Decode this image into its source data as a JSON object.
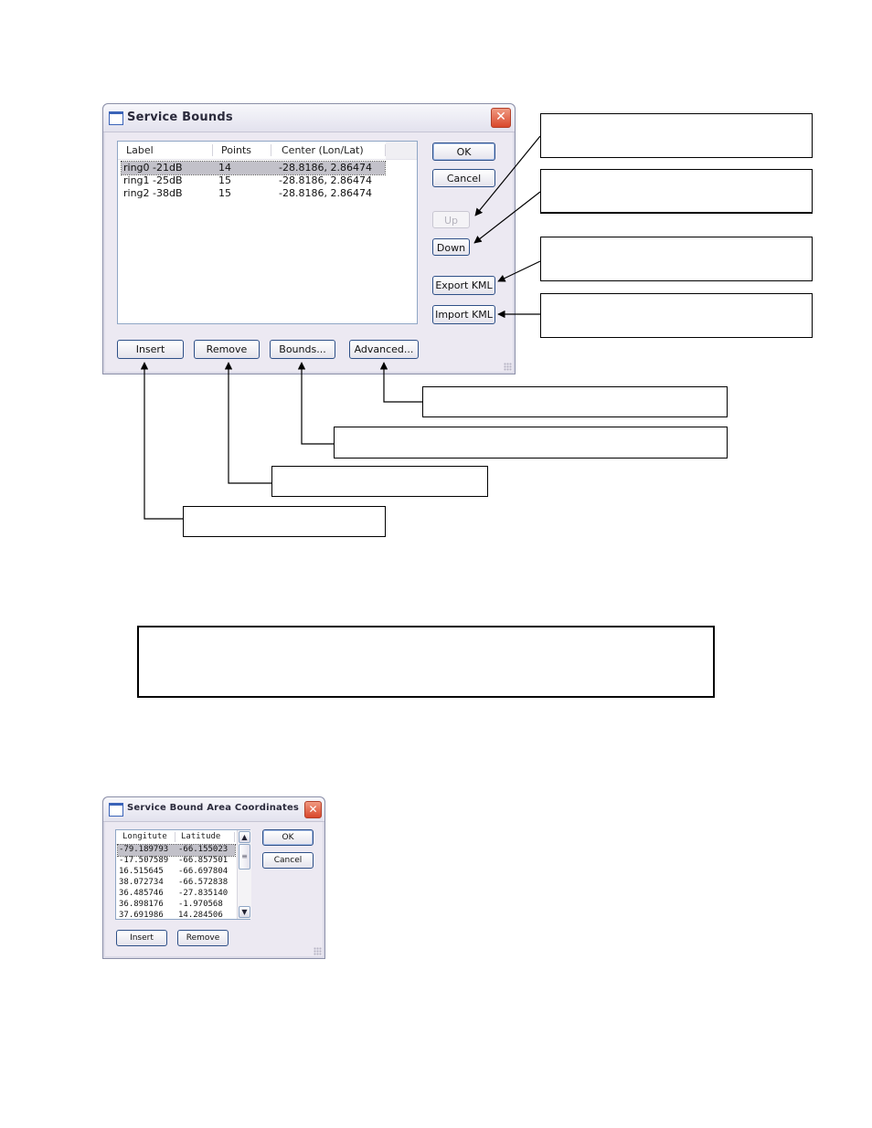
{
  "service_bounds_dialog": {
    "title": "Service Bounds",
    "close_glyph": "✕",
    "columns": [
      "Label",
      "Points",
      "Center (Lon/Lat)"
    ],
    "rows": [
      {
        "label": "ring0 -21dB",
        "points": "14",
        "center": "-28.8186, 2.86474",
        "selected": true
      },
      {
        "label": "ring1 -25dB",
        "points": "15",
        "center": "-28.8186, 2.86474",
        "selected": false
      },
      {
        "label": "ring2 -38dB",
        "points": "15",
        "center": "-28.8186, 2.86474",
        "selected": false
      }
    ],
    "buttons": {
      "ok": "OK",
      "cancel": "Cancel",
      "up": "Up",
      "down": "Down",
      "export_kml": "Export KML",
      "import_kml": "Import KML",
      "insert": "Insert",
      "remove": "Remove",
      "bounds": "Bounds...",
      "advanced": "Advanced..."
    },
    "up_disabled": true
  },
  "callouts": {
    "ok_cancel": "",
    "up_down": "",
    "export_kml": "",
    "import_kml": "",
    "advanced": "",
    "bounds": "",
    "remove": "",
    "insert": "",
    "middle_note": ""
  },
  "coordinates_dialog": {
    "title": "Service Bound Area Coordinates",
    "close_glyph": "✕",
    "columns": [
      "Longitute",
      "Latitude"
    ],
    "rows": [
      {
        "lon": "-79.189793",
        "lat": "-66.155023",
        "selected": true
      },
      {
        "lon": "-17.507589",
        "lat": "-66.857501",
        "selected": false
      },
      {
        "lon": "16.515645",
        "lat": "-66.697804",
        "selected": false
      },
      {
        "lon": "38.072734",
        "lat": "-66.572838",
        "selected": false
      },
      {
        "lon": "36.485746",
        "lat": "-27.835140",
        "selected": false
      },
      {
        "lon": "36.898176",
        "lat": "-1.970568",
        "selected": false
      },
      {
        "lon": "37.691986",
        "lat": "14.284506",
        "selected": false
      }
    ],
    "scroll_up_glyph": "▲",
    "scroll_down_glyph": "▼",
    "scroll_thumb_glyph": "≡",
    "buttons": {
      "ok": "OK",
      "cancel": "Cancel",
      "insert": "Insert",
      "remove": "Remove"
    }
  }
}
